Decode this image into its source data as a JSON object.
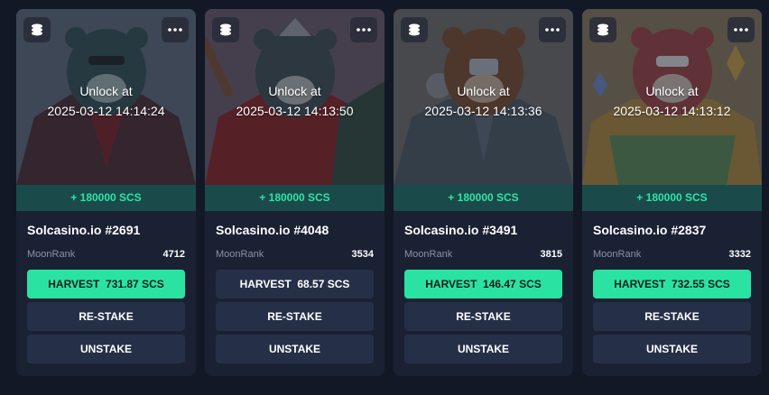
{
  "unlock_label": "Unlock at",
  "menu_icon": "more-horizontal-icon",
  "layers_icon": "layers-icon",
  "colors": {
    "accent": "#2ae3a2",
    "reward_text": "#2fe3a6",
    "card_bg": "#1a2133",
    "page_bg": "#121826"
  },
  "cards": [
    {
      "unlock_time": "2025-03-12 14:14:24",
      "reward": "+ 180000 SCS",
      "name": "Solcasino.io #2691",
      "rank_label": "MoonRank",
      "rank": "4712",
      "harvest_label": "HARVEST",
      "harvest_amount": "731.87 SCS",
      "harvest_enabled": true,
      "restake_label": "RE-STAKE",
      "unstake_label": "UNSTAKE"
    },
    {
      "unlock_time": "2025-03-12 14:13:50",
      "reward": "+ 180000 SCS",
      "name": "Solcasino.io #4048",
      "rank_label": "MoonRank",
      "rank": "3534",
      "harvest_label": "HARVEST",
      "harvest_amount": "68.57 SCS",
      "harvest_enabled": false,
      "restake_label": "RE-STAKE",
      "unstake_label": "UNSTAKE"
    },
    {
      "unlock_time": "2025-03-12 14:13:36",
      "reward": "+ 180000 SCS",
      "name": "Solcasino.io #3491",
      "rank_label": "MoonRank",
      "rank": "3815",
      "harvest_label": "HARVEST",
      "harvest_amount": "146.47 SCS",
      "harvest_enabled": true,
      "restake_label": "RE-STAKE",
      "unstake_label": "UNSTAKE"
    },
    {
      "unlock_time": "2025-03-12 14:13:12",
      "reward": "+ 180000 SCS",
      "name": "Solcasino.io #2837",
      "rank_label": "MoonRank",
      "rank": "3332",
      "harvest_label": "HARVEST",
      "harvest_amount": "732.55 SCS",
      "harvest_enabled": true,
      "restake_label": "RE-STAKE",
      "unstake_label": "UNSTAKE"
    }
  ]
}
